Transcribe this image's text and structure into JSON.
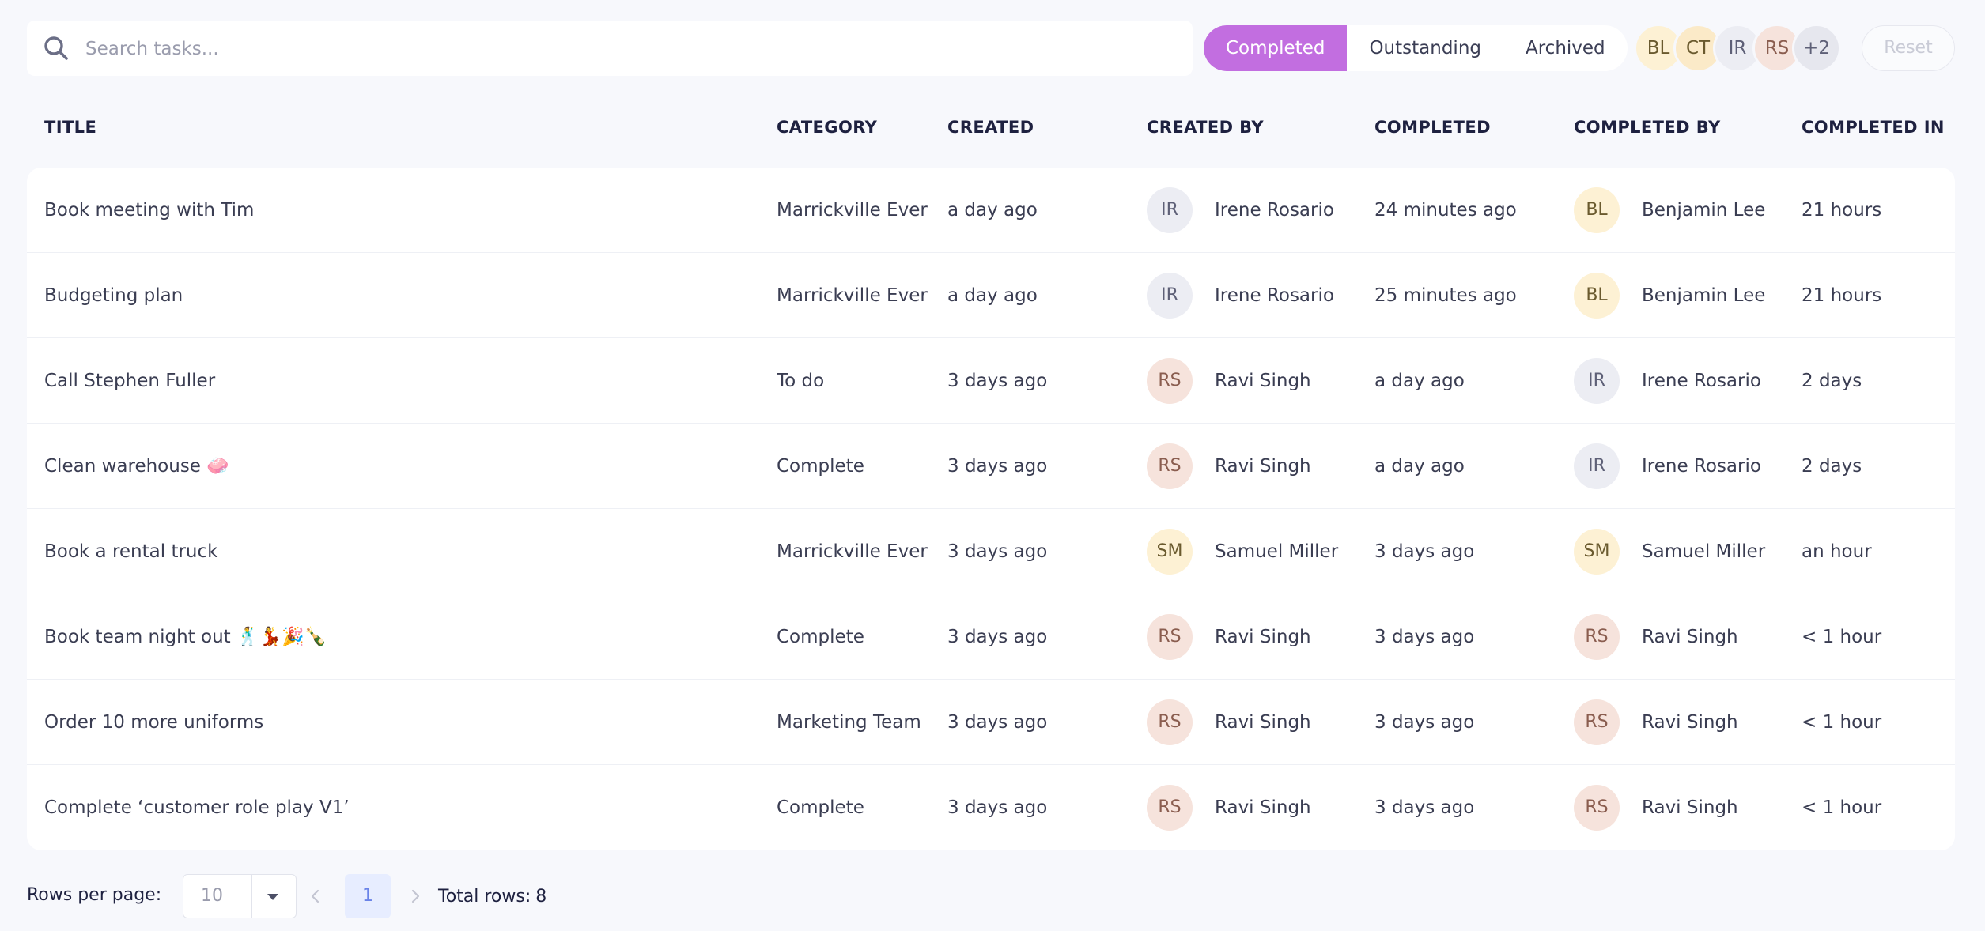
{
  "search": {
    "placeholder": "Search tasks..."
  },
  "filters": {
    "tabs": [
      {
        "label": "Completed",
        "active": true
      },
      {
        "label": "Outstanding",
        "active": false
      },
      {
        "label": "Archived",
        "active": false
      }
    ],
    "avatars": [
      {
        "initials": "BL",
        "bg": "#fdf1d4",
        "fg": "#6a5a2e"
      },
      {
        "initials": "CT",
        "bg": "#fbeac8",
        "fg": "#6a5a2e"
      },
      {
        "initials": "IR",
        "bg": "#ecedf3",
        "fg": "#5e6077"
      },
      {
        "initials": "RS",
        "bg": "#f6e3dc",
        "fg": "#8a5d4f"
      },
      {
        "initials": "+2",
        "bg": "#e6e7ee",
        "fg": "#5e6077"
      }
    ],
    "reset_label": "Reset"
  },
  "table": {
    "headers": {
      "title": "TITLE",
      "category": "CATEGORY",
      "created": "CREATED",
      "created_by": "CREATED BY",
      "completed": "COMPLETED",
      "completed_by": "COMPLETED BY",
      "completed_in": "COMPLETED IN"
    },
    "rows": [
      {
        "title": "Book meeting with Tim",
        "category": "Marrickville Ever",
        "created": "a day ago",
        "created_by": {
          "initials": "IR",
          "name": "Irene Rosario"
        },
        "completed": "24 minutes ago",
        "completed_by": {
          "initials": "BL",
          "name": "Benjamin Lee"
        },
        "completed_in": "21 hours"
      },
      {
        "title": "Budgeting plan",
        "category": "Marrickville Ever",
        "created": "a day ago",
        "created_by": {
          "initials": "IR",
          "name": "Irene Rosario"
        },
        "completed": "25 minutes ago",
        "completed_by": {
          "initials": "BL",
          "name": "Benjamin Lee"
        },
        "completed_in": "21 hours"
      },
      {
        "title": "Call Stephen Fuller",
        "category": "To do",
        "created": "3 days ago",
        "created_by": {
          "initials": "RS",
          "name": "Ravi Singh"
        },
        "completed": "a day ago",
        "completed_by": {
          "initials": "IR",
          "name": "Irene Rosario"
        },
        "completed_in": "2 days"
      },
      {
        "title": "Clean warehouse 🧼",
        "category": "Complete",
        "created": "3 days ago",
        "created_by": {
          "initials": "RS",
          "name": "Ravi Singh"
        },
        "completed": "a day ago",
        "completed_by": {
          "initials": "IR",
          "name": "Irene Rosario"
        },
        "completed_in": "2 days"
      },
      {
        "title": "Book a rental truck",
        "category": "Marrickville Ever",
        "created": "3 days ago",
        "created_by": {
          "initials": "SM",
          "name": "Samuel Miller"
        },
        "completed": "3 days ago",
        "completed_by": {
          "initials": "SM",
          "name": "Samuel Miller"
        },
        "completed_in": "an hour"
      },
      {
        "title": "Book team night out 🕺💃🎉🍾",
        "category": "Complete",
        "created": "3 days ago",
        "created_by": {
          "initials": "RS",
          "name": "Ravi Singh"
        },
        "completed": "3 days ago",
        "completed_by": {
          "initials": "RS",
          "name": "Ravi Singh"
        },
        "completed_in": "< 1 hour"
      },
      {
        "title": "Order 10 more uniforms",
        "category": "Marketing Team",
        "created": "3 days ago",
        "created_by": {
          "initials": "RS",
          "name": "Ravi Singh"
        },
        "completed": "3 days ago",
        "completed_by": {
          "initials": "RS",
          "name": "Ravi Singh"
        },
        "completed_in": "< 1 hour"
      },
      {
        "title": "Complete ‘customer role play V1’",
        "category": "Complete",
        "created": "3 days ago",
        "created_by": {
          "initials": "RS",
          "name": "Ravi Singh"
        },
        "completed": "3 days ago",
        "completed_by": {
          "initials": "RS",
          "name": "Ravi Singh"
        },
        "completed_in": "< 1 hour"
      }
    ]
  },
  "avatar_colors": {
    "IR": {
      "bg": "#ecedf3",
      "fg": "#5e6077"
    },
    "BL": {
      "bg": "#fdf1d4",
      "fg": "#6a5a2e"
    },
    "RS": {
      "bg": "#f6e3dc",
      "fg": "#8a5d4f"
    },
    "SM": {
      "bg": "#fdf1d4",
      "fg": "#6a5a2e"
    },
    "CT": {
      "bg": "#fbeac8",
      "fg": "#6a5a2e"
    }
  },
  "pagination": {
    "rows_per_page_label": "Rows per page:",
    "rows_per_page_value": "10",
    "current_page": "1",
    "total_label": "Total rows:",
    "total_value": "8"
  },
  "icons": {
    "search": "search-icon",
    "dropdown": "caret-down-icon",
    "prev": "chevron-left-icon",
    "next": "chevron-right-icon"
  },
  "colors": {
    "accent": "#c26ee0",
    "page_highlight_bg": "#e7edff",
    "page_highlight_fg": "#6a83e8"
  }
}
